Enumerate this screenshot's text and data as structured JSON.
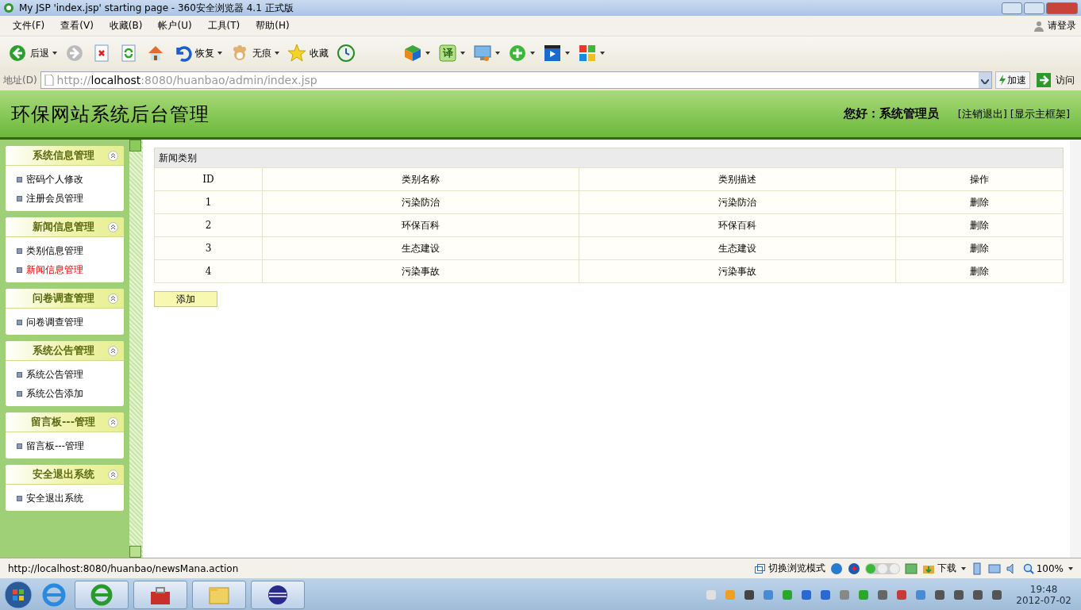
{
  "window": {
    "title": "My JSP 'index.jsp' starting page - 360安全浏览器 4.1 正式版"
  },
  "menu": [
    "文件(F)",
    "查看(V)",
    "收藏(B)",
    "帐户(U)",
    "工具(T)",
    "帮助(H)"
  ],
  "login": "请登录",
  "toolbar": [
    {
      "kind": "back",
      "label": "后退",
      "dropdown": true
    },
    {
      "kind": "forward",
      "dropdown": false
    },
    {
      "kind": "stop",
      "dropdown": false
    },
    {
      "kind": "refresh",
      "dropdown": false
    },
    {
      "kind": "home",
      "dropdown": false
    },
    {
      "kind": "undo",
      "label": "恢复",
      "dropdown": true
    },
    {
      "kind": "paw",
      "label": "无痕",
      "dropdown": true
    },
    {
      "kind": "star",
      "label": "收藏",
      "dropdown": false
    },
    {
      "kind": "clock",
      "dropdown": false
    },
    {
      "kind": "cube",
      "dropdown": true
    },
    {
      "kind": "translate",
      "label": "译",
      "dropdown": true
    },
    {
      "kind": "screen",
      "dropdown": true
    },
    {
      "kind": "plus",
      "dropdown": true
    },
    {
      "kind": "video",
      "dropdown": true
    },
    {
      "kind": "apps",
      "dropdown": true
    }
  ],
  "address": {
    "label": "地址(D)",
    "url": "http://**localhost**:8080/huanbao/admin/index.jsp",
    "speed": "加速",
    "go": "访问"
  },
  "header": {
    "title": "环保网站系统后台管理",
    "greeting": "您好：系统管理员",
    "links": [
      "[注销退出]",
      "[显示主框架]"
    ]
  },
  "sidebar": {
    "groups": [
      {
        "title": "系统信息管理",
        "items": [
          {
            "label": "密码个人修改",
            "selected": false
          },
          {
            "label": "注册会员管理",
            "selected": false
          }
        ]
      },
      {
        "title": "新闻信息管理",
        "items": [
          {
            "label": "类别信息管理",
            "selected": false
          },
          {
            "label": "新闻信息管理",
            "selected": true
          }
        ]
      },
      {
        "title": "问卷调查管理",
        "items": [
          {
            "label": "问卷调查管理",
            "selected": false
          }
        ]
      },
      {
        "title": "系统公告管理",
        "items": [
          {
            "label": "系统公告管理",
            "selected": false
          },
          {
            "label": "系统公告添加",
            "selected": false
          }
        ]
      },
      {
        "title": "留言板---管理",
        "items": [
          {
            "label": "留言板---管理",
            "selected": false
          }
        ]
      },
      {
        "title": "安全退出系统",
        "items": [
          {
            "label": "安全退出系统",
            "selected": false
          }
        ]
      }
    ]
  },
  "table": {
    "caption": "新闻类别",
    "columns": [
      "ID",
      "类别名称",
      "类别描述",
      "操作"
    ],
    "rows": [
      [
        "1",
        "污染防治",
        "污染防治",
        "删除"
      ],
      [
        "2",
        "环保百科",
        "环保百科",
        "删除"
      ],
      [
        "3",
        "生态建设",
        "生态建设",
        "删除"
      ],
      [
        "4",
        "污染事故",
        "污染事故",
        "删除"
      ]
    ]
  },
  "add_button": "添加",
  "status_bar": {
    "url": "http://localhost:8080/huanbao/newsMana.action",
    "mode": "切换浏览模式",
    "download": "下载",
    "zoom": "100%"
  },
  "taskbar": {
    "time": "19:48",
    "date": "2012-07-02"
  }
}
